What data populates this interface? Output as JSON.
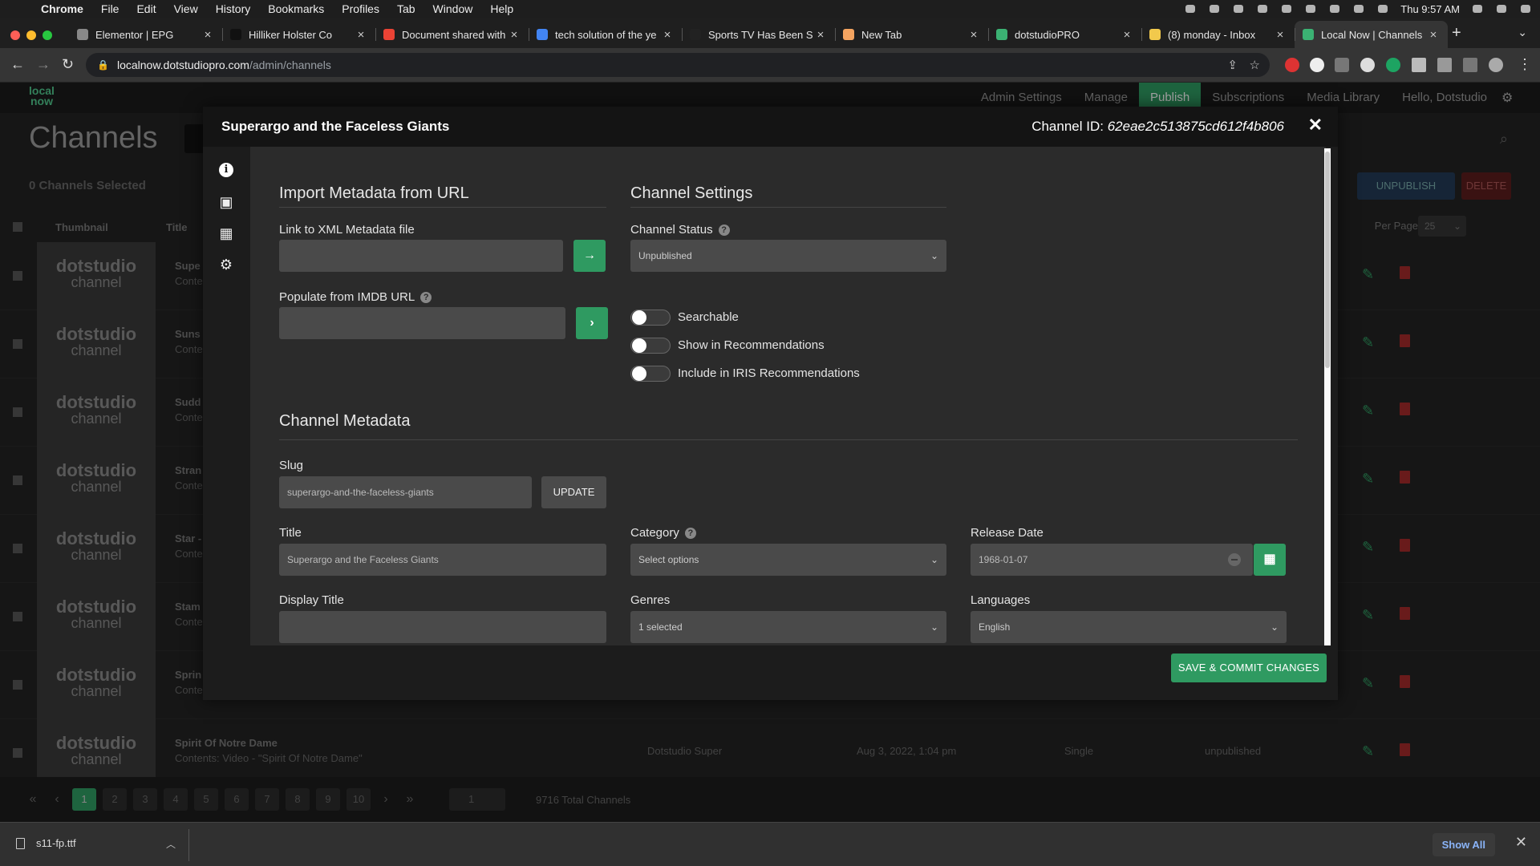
{
  "menubar": {
    "app": "Chrome",
    "items": [
      "File",
      "Edit",
      "View",
      "History",
      "Bookmarks",
      "Profiles",
      "Tab",
      "Window",
      "Help"
    ],
    "clock": "Thu 9:57 AM"
  },
  "tabs": [
    {
      "title": "Elementor | EPG",
      "color": "#888888"
    },
    {
      "title": "Hilliker Holster Co",
      "color": "#111111"
    },
    {
      "title": "Document shared with",
      "color": "#ea4335"
    },
    {
      "title": "tech solution of the ye",
      "color": "#4285f4"
    },
    {
      "title": "Sports TV Has Been S",
      "color": "#222222"
    },
    {
      "title": "New Tab",
      "color": "#f4a460"
    },
    {
      "title": "dotstudioPRO",
      "color": "#3bb273"
    },
    {
      "title": "(8) monday - Inbox",
      "color": "#f2c94c"
    },
    {
      "title": "Local Now | Channels",
      "color": "#3bb273"
    }
  ],
  "address": {
    "host": "localnow.dotstudiopro.com",
    "path": "/admin/channels"
  },
  "app": {
    "logo": "local now",
    "nav": [
      "Admin Settings",
      "Manage",
      "Publish",
      "Subscriptions",
      "Media Library",
      "Hello, Dotstudio"
    ],
    "active_nav": "Publish"
  },
  "background": {
    "page_title": "Channels",
    "selected_info": "0 Channels  Selected",
    "buttons": {
      "unpublish": "UNPUBLISH",
      "delete": "DELETE"
    },
    "columns": {
      "thumbnail": "Thumbnail",
      "title": "Title"
    },
    "per_page_label": "Per Page",
    "per_page_value": "25",
    "thumb_brand": "dotstudio",
    "thumb_sub": "channel",
    "rows": [
      {
        "title": "Supe",
        "sub": "Conte"
      },
      {
        "title": "Suns",
        "sub": "Conte"
      },
      {
        "title": "Sudd",
        "sub": "Conte"
      },
      {
        "title": "Stran",
        "sub": "Conte"
      },
      {
        "title": "Star -",
        "sub": "Conte"
      },
      {
        "title": "Stam",
        "sub": "Conte"
      },
      {
        "title": "Sprin",
        "sub": "Contents: Video - \"Springtime In The Sierras\""
      },
      {
        "title": "Spirit Of Notre Dame",
        "sub": "Contents: Video - \"Spirit Of Notre Dame\"",
        "company": "Dotstudio Super",
        "date": "Aug 3, 2022, 1:04 pm",
        "type": "Single",
        "status": "unpublished"
      }
    ],
    "pages": [
      "1",
      "2",
      "3",
      "4",
      "5",
      "6",
      "7",
      "8",
      "9",
      "10"
    ],
    "page_select": "1",
    "total": "9716 Total Channels"
  },
  "downloads": {
    "file": "s11-fp.ttf",
    "show_all": "Show All"
  },
  "modal": {
    "title": "Superargo and the Faceless Giants",
    "channel_id_label": "Channel ID:",
    "channel_id": "62eae2c513875cd612f4b806",
    "import": {
      "heading": "Import Metadata from URL",
      "xml_label": "Link to XML Metadata file",
      "xml_value": "",
      "imdb_label": "Populate from IMDB URL",
      "imdb_value": ""
    },
    "settings": {
      "heading": "Channel Settings",
      "status_label": "Channel Status",
      "status_value": "Unpublished",
      "toggles": [
        {
          "label": "Searchable",
          "on": false
        },
        {
          "label": "Show in Recommendations",
          "on": false
        },
        {
          "label": "Include in IRIS Recommendations",
          "on": false
        }
      ]
    },
    "metadata": {
      "heading": "Channel Metadata",
      "slug_label": "Slug",
      "slug_value": "superargo-and-the-faceless-giants",
      "update_label": "UPDATE",
      "title_label": "Title",
      "title_value": "Superargo and the Faceless Giants",
      "category_label": "Category",
      "category_value": "Select options",
      "release_label": "Release Date",
      "release_value": "1968-01-07",
      "display_title_label": "Display Title",
      "display_title_value": "",
      "genres_label": "Genres",
      "genres_value": "1 selected",
      "languages_label": "Languages",
      "languages_value": "English"
    },
    "save_label": "SAVE & COMMIT CHANGES"
  }
}
